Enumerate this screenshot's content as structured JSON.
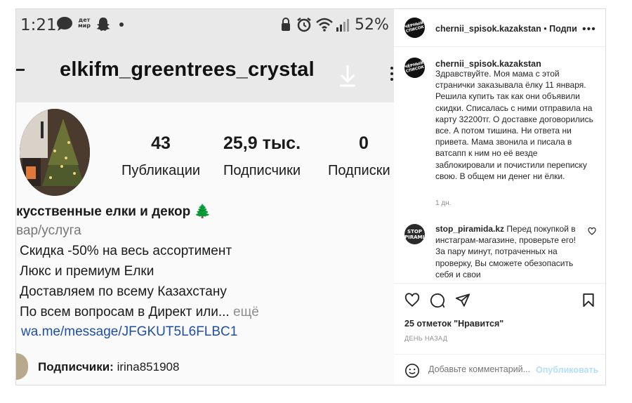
{
  "phone": {
    "status_time": "1:21",
    "status_badge": "дет мир",
    "status_battery": "52%",
    "profile_name": "elkifm_greentrees_crystal",
    "stats": [
      {
        "value": "43",
        "label": "Публикации"
      },
      {
        "value": "25,9 тыс.",
        "label": "Подписчики"
      },
      {
        "value": "0",
        "label": "Подписки"
      }
    ],
    "bio": {
      "title": "кусственные елки и декор 🌲",
      "category": "вар/услуга",
      "line1": "Скидка -50% на весь ассортимент",
      "line2": "Люкс и премиум Елки",
      "line3": "Доставляем по всему Казахстану",
      "line4": "По всем вопросам в Директ или...",
      "more": " ещё",
      "link": "wa.me/message/JFGKUT5L6FLBC1"
    },
    "followers_label": "Подписчики:",
    "followers_value": "irina851908"
  },
  "post": {
    "author": "chernii_spisok.kazakstan",
    "dot": "•",
    "follow": "Подпи",
    "author_logo": "ЧЁРНЫЙ СПИСОК",
    "caption_user": "chernii_spisok.kazakstan",
    "caption_text": "Здравствуйте. Моя мама с этой странички заказывала ёлку 11 января. Решила купить так как они объявили скидки. Списалась с ними отправила на карту 32200тг. О доставке договорились все. А потом тишина. Ни ответа ни привета. Мама звонила и писала в ватсапп к ним но её везде заблокировали и почистили переписку свою. В общем ни денег ни ёлки.",
    "caption_time": "1 дн.",
    "comment": {
      "user": "stop_piramida.kz",
      "avatar_text": "STOP PIRAMIDA",
      "text": " Перед покупкой в инстаграм-магазине, проверьте его! За пару минут, потраченных на проверку, Вы сможете обезопасить себя и свои"
    },
    "likes": "25 отметок \"Нравится\"",
    "ago": "ДЕНЬ НАЗАД",
    "add_comment_placeholder": "Добавьте комментарий...",
    "publish": "Опубликовать"
  }
}
